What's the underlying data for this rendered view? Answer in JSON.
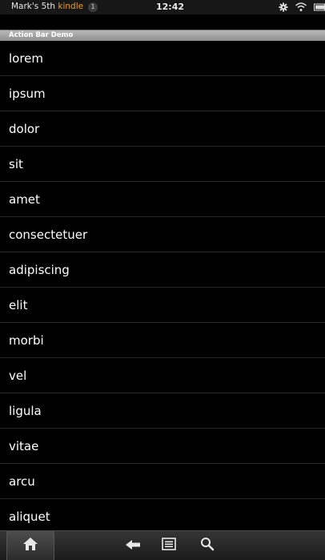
{
  "status_bar": {
    "device_name_prefix": "Mark's 5th ",
    "device_name_brand": "kindle",
    "notification_count": "1",
    "time": "12:42",
    "icons": [
      "gear-icon",
      "wifi-icon",
      "battery-icon"
    ]
  },
  "action_bar": {
    "title": "Action Bar Demo"
  },
  "list": {
    "items": [
      "lorem",
      "ipsum",
      "dolor",
      "sit",
      "amet",
      "consectetuer",
      "adipiscing",
      "elit",
      "morbi",
      "vel",
      "ligula",
      "vitae",
      "arcu",
      "aliquet"
    ]
  },
  "nav_bar": {
    "buttons": [
      "home-icon",
      "back-icon",
      "menu-icon",
      "search-icon"
    ]
  },
  "colors": {
    "brand": "#f0a01e",
    "background": "#000000",
    "action_bar": "#a8a8a8"
  }
}
